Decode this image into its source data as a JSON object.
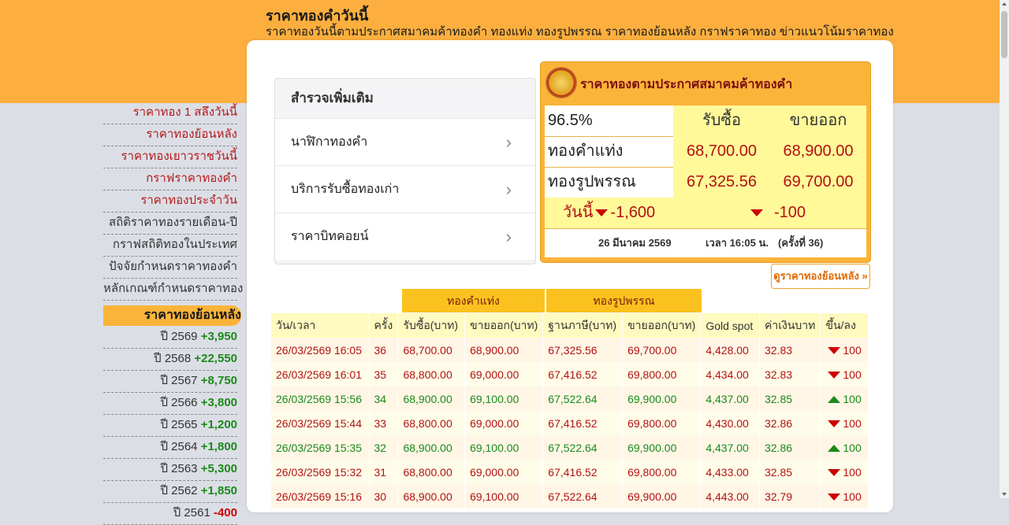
{
  "header": {
    "title": "ราคาทองคำวันนี้",
    "subtitle": "ราคาทองวันนี้ตามประกาศสมาคมค้าทองคำ ทองแท่ง ทองรูปพรรณ ราคาทองย้อนหลัง กราฟราคาทอง ข่าวแนวโน้มราคาทอง"
  },
  "nav": {
    "items": [
      {
        "label": "ราคาทอง 1 สลึงวันนี้",
        "style": "red"
      },
      {
        "label": "ราคาทองย้อนหลัง",
        "style": "red"
      },
      {
        "label": "ราคาทองเยาวราชวันนี้",
        "style": "red"
      },
      {
        "label": "กราฟราคาทองคำ",
        "style": "red"
      },
      {
        "label": "ราคาทองประจำวัน",
        "style": "red"
      },
      {
        "label": "สถิติราคาทองรายเดือน-ปี",
        "style": "dark"
      },
      {
        "label": "กราฟสถิติทองในประเทศ",
        "style": "dark"
      },
      {
        "label": "ปัจจัยกำหนดราคาทองคำ",
        "style": "dark"
      },
      {
        "label": "หลักเกณฑ์กำหนดราคาทอง",
        "style": "dark"
      }
    ],
    "active_label": "ราคาทองย้อนหลัง",
    "years": [
      {
        "year": "ปี 2569",
        "change": "+3,950"
      },
      {
        "year": "ปี 2568",
        "change": "+22,550"
      },
      {
        "year": "ปี 2567",
        "change": "+8,750"
      },
      {
        "year": "ปี 2566",
        "change": "+3,800"
      },
      {
        "year": "ปี 2565",
        "change": "+1,200"
      },
      {
        "year": "ปี 2564",
        "change": "+1,800"
      },
      {
        "year": "ปี 2563",
        "change": "+5,300"
      },
      {
        "year": "ปี 2562",
        "change": "+1,850"
      },
      {
        "year": "ปี 2561",
        "change": "-400"
      }
    ]
  },
  "explore": {
    "title": "สำรวจเพิ่มเติม",
    "items": [
      "นาฬิกาทองคำ",
      "บริการรับซื้อทองเก่า",
      "ราคาบิทคอยน์"
    ]
  },
  "price_box": {
    "title": "ราคาทองตามประกาศสมาคมค้าทองคำ",
    "purity": "96.5%",
    "buy_label": "รับซื้อ",
    "sell_label": "ขายออก",
    "bar_label": "ทองคำแท่ง",
    "bar_buy": "68,700.00",
    "bar_sell": "68,900.00",
    "orn_label": "ทองรูปพรรณ",
    "orn_buy": "67,325.56",
    "orn_sell": "69,700.00",
    "today_label": "วันนี้",
    "today_change": "-1,600",
    "change_per_update": "-100",
    "date": "26 มีนาคม 2569",
    "time": "เวลา 16:05 น.",
    "round": "(ครั้งที่ 36)"
  },
  "history_button": "ดูราคาทองย้อนหลัง »",
  "table": {
    "group_bar": "ทองคำแท่ง",
    "group_orn": "ทองรูปพรรณ",
    "columns": [
      "วัน/เวลา",
      "ครั้ง",
      "รับซื้อ(บาท)",
      "ขายออก(บาท)",
      "ฐานภาษี(บาท)",
      "ขายออก(บาท)",
      "Gold spot",
      "ค่าเงินบาท",
      "ขึ้น/ลง"
    ],
    "rows": [
      {
        "dir": "dn",
        "cells": [
          "26/03/2569 16:05",
          "36",
          "68,700.00",
          "68,900.00",
          "67,325.56",
          "69,700.00",
          "4,428.00",
          "32.83",
          "100"
        ]
      },
      {
        "dir": "dn",
        "cells": [
          "26/03/2569 16:01",
          "35",
          "68,800.00",
          "69,000.00",
          "67,416.52",
          "69,800.00",
          "4,434.00",
          "32.83",
          "100"
        ]
      },
      {
        "dir": "up",
        "cells": [
          "26/03/2569 15:56",
          "34",
          "68,900.00",
          "69,100.00",
          "67,522.64",
          "69,900.00",
          "4,437.00",
          "32.85",
          "100"
        ]
      },
      {
        "dir": "dn",
        "cells": [
          "26/03/2569 15:44",
          "33",
          "68,800.00",
          "69,000.00",
          "67,416.52",
          "69,800.00",
          "4,430.00",
          "32.86",
          "100"
        ]
      },
      {
        "dir": "up",
        "cells": [
          "26/03/2569 15:35",
          "32",
          "68,900.00",
          "69,100.00",
          "67,522.64",
          "69,900.00",
          "4,437.00",
          "32.86",
          "100"
        ]
      },
      {
        "dir": "dn",
        "cells": [
          "26/03/2569 15:32",
          "31",
          "68,800.00",
          "69,000.00",
          "67,416.52",
          "69,800.00",
          "4,433.00",
          "32.85",
          "100"
        ]
      },
      {
        "dir": "dn",
        "cells": [
          "26/03/2569 15:16",
          "30",
          "68,900.00",
          "69,100.00",
          "67,522.64",
          "69,900.00",
          "4,443.00",
          "32.79",
          "100"
        ]
      }
    ]
  },
  "colors": {
    "header_orange": "#fcaf3f",
    "price_red": "#b31212",
    "up_green": "#1a8a1a",
    "table_group_yellow": "#fbc21f"
  }
}
